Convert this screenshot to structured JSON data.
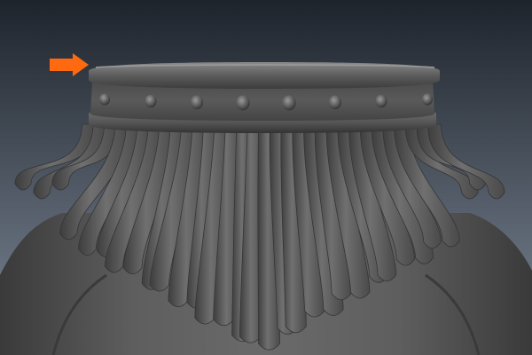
{
  "viewport": {
    "background_top": "#1e242c",
    "background_bottom": "#7d8897",
    "mesh_color": "#5a5a5a",
    "mesh_light": "#8a8a8a",
    "mesh_dark": "#2e2e2e"
  },
  "annotation": {
    "arrow_icon": "arrow-right-icon",
    "arrow_color": "#ff6a10"
  },
  "model": {
    "rivet_count": 8,
    "fringe_strip_count": 32
  }
}
